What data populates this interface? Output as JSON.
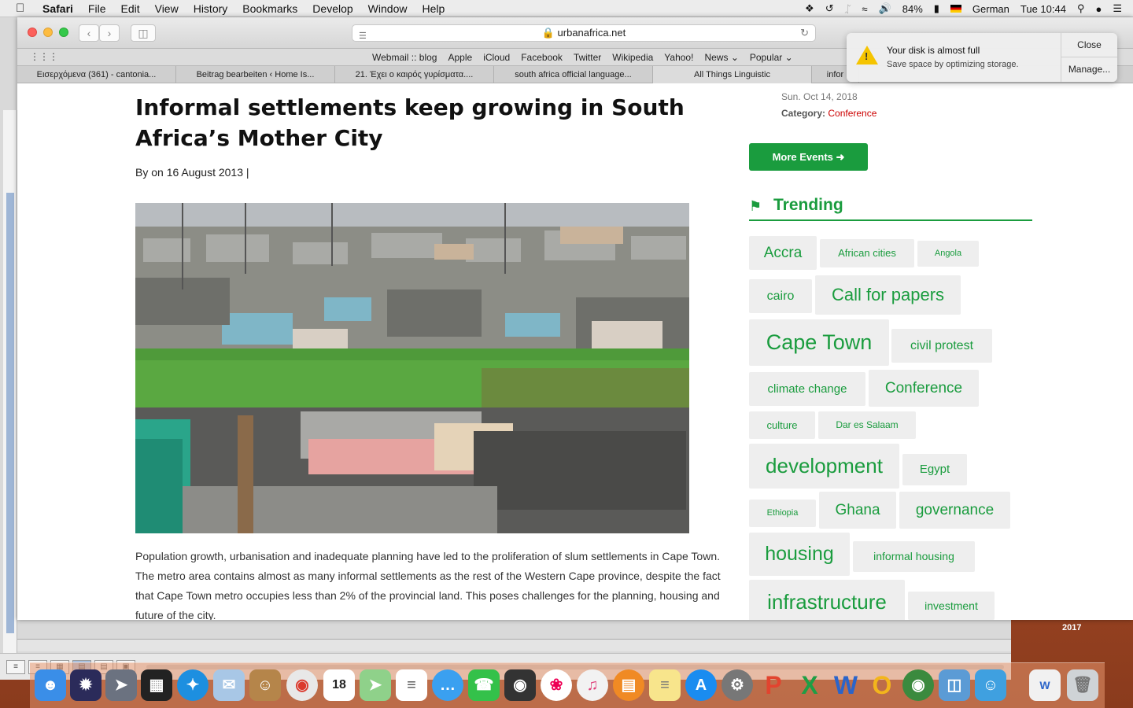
{
  "menubar": {
    "app": "Safari",
    "items": [
      "File",
      "Edit",
      "View",
      "History",
      "Bookmarks",
      "Develop",
      "Window",
      "Help"
    ],
    "battery": "84%",
    "input_source": "German",
    "clock": "Tue 10:44"
  },
  "browser": {
    "url": "urbanafrica.net",
    "favorites": [
      "Webmail :: blog",
      "Apple",
      "iCloud",
      "Facebook",
      "Twitter",
      "Wikipedia",
      "Yahoo!",
      "News",
      "Popular"
    ],
    "tabs": [
      "Εισερχόμενα (361) - cantonia...",
      "Beitrag bearbeiten ‹ Home Is...",
      "21. Έχει ο καιρός γυρίσματα....",
      "south africa official language...",
      "All Things Linguistic",
      "infor"
    ]
  },
  "notification": {
    "title": "Your disk is almost full",
    "body": "Save space by optimizing storage.",
    "close": "Close",
    "manage": "Manage..."
  },
  "article": {
    "title": "Informal settlements keep growing in South Africa’s Mother City",
    "byline": "By on 16 August 2013 |",
    "paragraph": "Population growth, urbanisation and inadequate planning have led to the proliferation of slum settlements in Cape Town. The metro area contains almost as many informal settlements as the rest of the Western Cape province, despite the fact that Cape Town metro occupies less than 2% of the provincial land. This poses challenges for the planning, housing and future of the city."
  },
  "sidebar": {
    "event_date": "Sun. Oct 14, 2018",
    "category_label": "Category:",
    "category_value": "Conference",
    "more_events": "More Events",
    "trending": "Trending",
    "tags": [
      "Accra",
      "African cities",
      "Angola",
      "cairo",
      "Call for papers",
      "Cape Town",
      "civil protest",
      "climate change",
      "Conference",
      "culture",
      "Dar es Salaam",
      "development",
      "Egypt",
      "Ethiopia",
      "Ghana",
      "governance",
      "housing",
      "informal housing",
      "infrastructure",
      "investment"
    ]
  },
  "desktop": {
    "folder_label": "2017"
  },
  "colors": {
    "accent_green": "#1a9c3e",
    "category_red": "#cc0000"
  }
}
